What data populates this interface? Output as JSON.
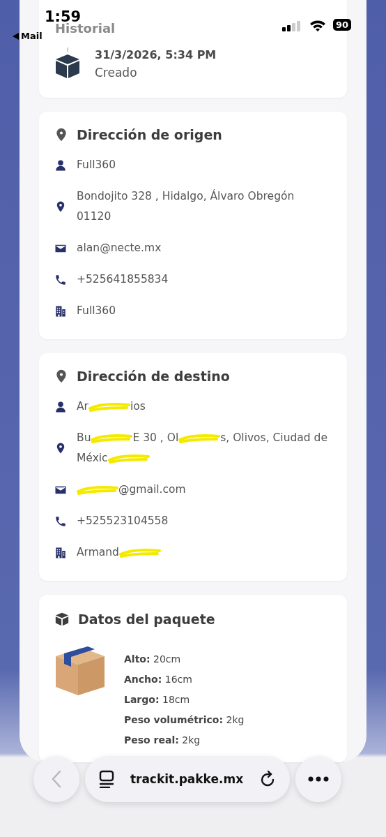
{
  "status_bar": {
    "time": "1:59",
    "back_app": "Mail",
    "battery": "90"
  },
  "history": {
    "title": "Historial",
    "events": [
      {
        "date": "31/3/2026, 5:34 PM",
        "status": "Creado"
      }
    ]
  },
  "origin": {
    "title": "Dirección de origen",
    "rows": [
      {
        "kind": "person",
        "segments": [
          {
            "kind": "text",
            "text": "Full360"
          }
        ]
      },
      {
        "kind": "pin",
        "segments": [
          {
            "kind": "text",
            "text": "Bondojito 328 , Hidalgo, Álvaro Obregón 01120"
          }
        ]
      },
      {
        "kind": "mail",
        "segments": [
          {
            "kind": "text",
            "text": "alan@necte.mx"
          }
        ]
      },
      {
        "kind": "phone",
        "segments": [
          {
            "kind": "text",
            "text": "+525641855834"
          }
        ]
      },
      {
        "kind": "company",
        "segments": [
          {
            "kind": "text",
            "text": "Full360"
          }
        ]
      }
    ]
  },
  "destination": {
    "title": "Dirección de destino",
    "rows": [
      {
        "kind": "person",
        "segments": [
          {
            "kind": "text",
            "text": "Ar"
          },
          {
            "kind": "scribble"
          },
          {
            "kind": "text",
            "text": "ios"
          }
        ]
      },
      {
        "kind": "pin",
        "segments": [
          {
            "kind": "text",
            "text": "Bu"
          },
          {
            "kind": "scribble"
          },
          {
            "kind": "text",
            "text": "E 30 , Ol"
          },
          {
            "kind": "scribble"
          },
          {
            "kind": "text",
            "text": "s, Olivos, Ciudad de Méxic"
          },
          {
            "kind": "scribble"
          }
        ]
      },
      {
        "kind": "mail",
        "segments": [
          {
            "kind": "scribble"
          },
          {
            "kind": "text",
            "text": "@gmail.com"
          }
        ]
      },
      {
        "kind": "phone",
        "segments": [
          {
            "kind": "text",
            "text": "+525523104558"
          }
        ]
      },
      {
        "kind": "company",
        "segments": [
          {
            "kind": "text",
            "text": "Armand"
          },
          {
            "kind": "scribble"
          }
        ]
      }
    ]
  },
  "package": {
    "title": "Datos del paquete",
    "fields": [
      {
        "label": "Alto:",
        "value": "20cm"
      },
      {
        "label": "Ancho:",
        "value": "16cm"
      },
      {
        "label": "Largo:",
        "value": "18cm"
      },
      {
        "label": "Peso volumétrico:",
        "value": "2kg"
      },
      {
        "label": "Peso real:",
        "value": "2kg"
      }
    ]
  },
  "browser_bar": {
    "url": "trackit.pakke.mx"
  }
}
